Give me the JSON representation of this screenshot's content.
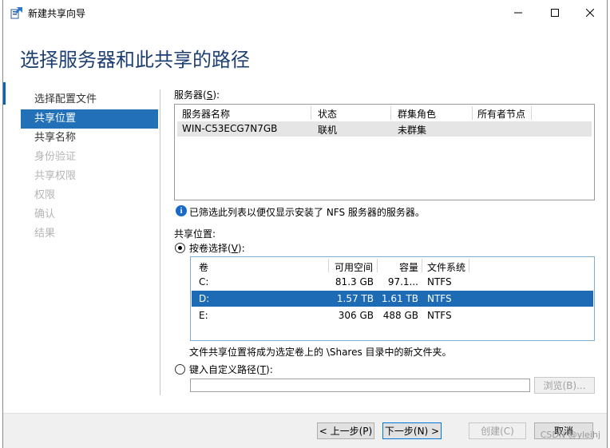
{
  "window": {
    "title": "新建共享向导",
    "page_header": "选择服务器和此共享的路径"
  },
  "nav": {
    "items": [
      {
        "label": "选择配置文件",
        "state": "normal"
      },
      {
        "label": "共享位置",
        "state": "selected"
      },
      {
        "label": "共享名称",
        "state": "normal"
      },
      {
        "label": "身份验证",
        "state": "disabled"
      },
      {
        "label": "共享权限",
        "state": "disabled"
      },
      {
        "label": "权限",
        "state": "disabled"
      },
      {
        "label": "确认",
        "state": "disabled"
      },
      {
        "label": "结果",
        "state": "disabled"
      }
    ]
  },
  "servers": {
    "label_prefix": "服务器(",
    "label_key": "S",
    "label_suffix": "):",
    "columns": [
      "服务器名称",
      "状态",
      "群集角色",
      "所有者节点"
    ],
    "rows": [
      {
        "name": "WIN-C53ECG7N7GB",
        "status": "联机",
        "cluster_role": "未群集",
        "owner_node": ""
      }
    ]
  },
  "info": {
    "icon": "info-icon",
    "text": "已筛选此列表以便仅显示安装了 NFS 服务器的服务器。"
  },
  "share_location": {
    "label": "共享位置:",
    "by_volume": {
      "prefix": "按卷选择(",
      "key": "V",
      "suffix": "):",
      "checked": true
    },
    "volume_columns": [
      "卷",
      "可用空间",
      "容量",
      "文件系统"
    ],
    "volumes": [
      {
        "volume": "C:",
        "free": "81.3 GB",
        "capacity": "97.1...",
        "fs": "NTFS",
        "selected": false
      },
      {
        "volume": "D:",
        "free": "1.57 TB",
        "capacity": "1.61 TB",
        "fs": "NTFS",
        "selected": true
      },
      {
        "volume": "E:",
        "free": "306 GB",
        "capacity": "488 GB",
        "fs": "NTFS",
        "selected": false
      }
    ],
    "note": "文件共享位置将成为选定卷上的 \\Shares 目录中的新文件夹。",
    "custom_path": {
      "prefix": "键入自定义路径(",
      "key": "T",
      "suffix": "):",
      "checked": false,
      "value": ""
    },
    "browse_button": "浏览(B)..."
  },
  "footer": {
    "prev_button": "< 上一步(P)",
    "next_button": "下一步(N) >",
    "create_button": "创建(C)",
    "cancel_button": "取消"
  },
  "watermark": "CSDN @yleihj"
}
